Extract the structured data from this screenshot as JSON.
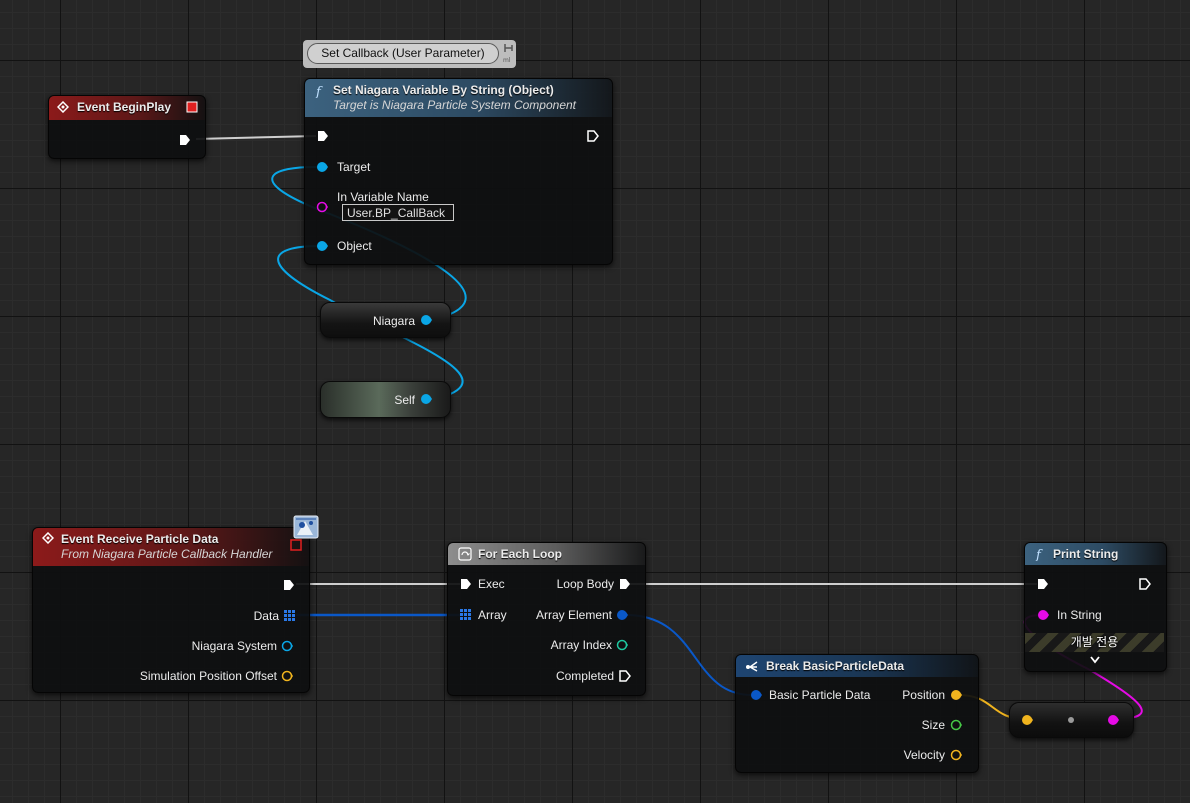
{
  "comment": {
    "text": "Set Callback (User Parameter)"
  },
  "event_begin_play": {
    "title": "Event BeginPlay"
  },
  "set_niagara": {
    "title": "Set Niagara Variable By String (Object)",
    "subtitle": "Target is Niagara Particle System Component",
    "pins": {
      "target": "Target",
      "in_variable_name": "In Variable Name",
      "object": "Object"
    },
    "in_variable_name_value": "User.BP_CallBack"
  },
  "var_niagara": {
    "label": "Niagara"
  },
  "var_self": {
    "label": "Self"
  },
  "event_receive": {
    "title": "Event Receive Particle Data",
    "subtitle": "From Niagara Particle Callback Handler",
    "pins": {
      "data": "Data",
      "niagara_system": "Niagara System",
      "sim_offset": "Simulation Position Offset"
    }
  },
  "for_each": {
    "title": "For Each Loop",
    "pins": {
      "exec": "Exec",
      "array": "Array",
      "loop_body": "Loop Body",
      "array_element": "Array Element",
      "array_index": "Array Index",
      "completed": "Completed"
    }
  },
  "print_string": {
    "title": "Print String",
    "pins": {
      "in_string": "In String"
    },
    "dev_only": "개발 전용"
  },
  "break_data": {
    "title": "Break BasicParticleData",
    "pins": {
      "basic_particle_data": "Basic Particle Data",
      "position": "Position",
      "size": "Size",
      "velocity": "Velocity"
    }
  },
  "colors": {
    "exec": "#ffffff",
    "object": "#0aa6e6",
    "string": "#e60ae6",
    "struct": "#0a58c8",
    "vector": "#f0b41e",
    "int": "#1ec8a0",
    "float": "#46c846"
  },
  "icons": {
    "event": "event-diamond-icon",
    "function": "function-f-icon",
    "loop": "macro-loop-icon",
    "break": "break-struct-icon",
    "delegate": "delegate-icon",
    "niagara": "niagara-callback-icon"
  }
}
